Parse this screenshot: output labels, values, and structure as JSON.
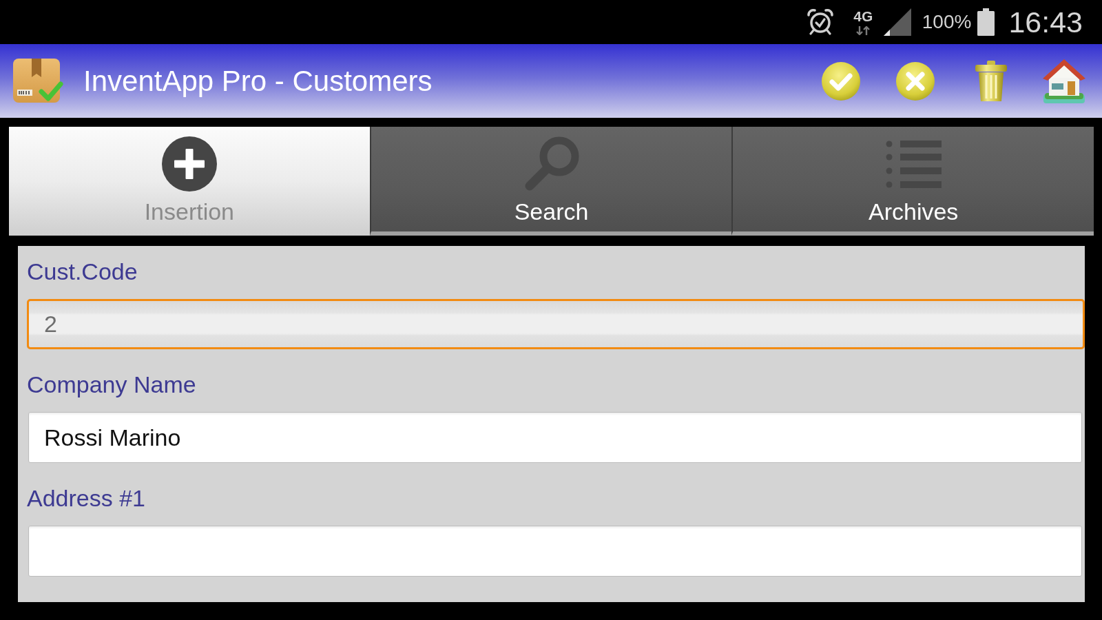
{
  "status_bar": {
    "network": "4G",
    "battery": "100%",
    "time": "16:43"
  },
  "app_bar": {
    "title": "InventApp Pro - Customers"
  },
  "tabs": [
    {
      "label": "Insertion",
      "selected": true
    },
    {
      "label": "Search",
      "selected": false
    },
    {
      "label": "Archives",
      "selected": false
    }
  ],
  "form": {
    "fields": [
      {
        "label": "Cust.Code",
        "value": "2",
        "focused": true,
        "disabled": true
      },
      {
        "label": "Company Name",
        "value": "Rossi Marino",
        "focused": false,
        "disabled": false
      },
      {
        "label": "Address #1",
        "focused": false,
        "disabled": false
      }
    ]
  }
}
